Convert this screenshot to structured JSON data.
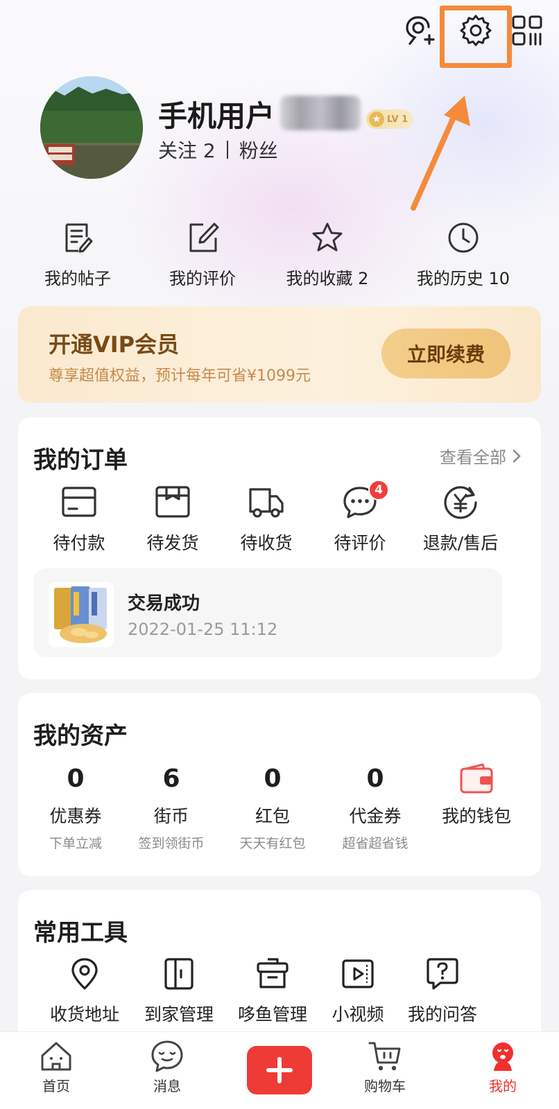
{
  "header": {
    "add_friend_icon": "person-add-icon",
    "settings_icon": "gear-icon",
    "qr_icon": "qr-code-icon",
    "highlight_color": "#f58a3b"
  },
  "profile": {
    "username": "手机用户",
    "level": "LV 1",
    "follow_label": "关注",
    "follow_count": "2",
    "fans_label": "粉丝"
  },
  "quick_links": [
    {
      "label": "我的帖子",
      "icon": "document-edit-icon"
    },
    {
      "label": "我的评价",
      "icon": "edit-square-icon"
    },
    {
      "label": "我的收藏  2",
      "icon": "star-icon"
    },
    {
      "label": "我的历史  10",
      "icon": "clock-icon"
    }
  ],
  "vip": {
    "title": "开通VIP会员",
    "subtitle": "尊享超值权益，预计每年可省¥1099元",
    "button": "立即续费"
  },
  "orders": {
    "title": "我的订单",
    "view_all": "查看全部",
    "items": [
      {
        "label": "待付款",
        "icon": "card-icon"
      },
      {
        "label": "待发货",
        "icon": "box-icon"
      },
      {
        "label": "待收货",
        "icon": "truck-icon"
      },
      {
        "label": "待评价",
        "icon": "chat-bubble-icon",
        "badge": "4"
      },
      {
        "label": "退款/售后",
        "icon": "refund-icon"
      }
    ],
    "recent": {
      "status": "交易成功",
      "time": "2022-01-25 11:12"
    }
  },
  "assets": {
    "title": "我的资产",
    "items": [
      {
        "value": "0",
        "name": "优惠券",
        "desc": "下单立减"
      },
      {
        "value": "6",
        "name": "街币",
        "desc": "签到领街币"
      },
      {
        "value": "0",
        "name": "红包",
        "desc": "天天有红包"
      },
      {
        "value": "0",
        "name": "代金券",
        "desc": "超省超省钱"
      }
    ],
    "wallet_label": "我的钱包"
  },
  "tools": {
    "title": "常用工具",
    "items": [
      {
        "label": "收货地址",
        "icon": "location-pin-icon"
      },
      {
        "label": "到家管理",
        "icon": "door-icon"
      },
      {
        "label": "哆鱼管理",
        "icon": "basket-icon"
      },
      {
        "label": "小视频",
        "icon": "video-icon"
      },
      {
        "label": "我的问答",
        "icon": "question-bubble-icon"
      }
    ]
  },
  "nav": {
    "items": [
      {
        "label": "首页",
        "icon": "home-icon"
      },
      {
        "label": "消息",
        "icon": "message-icon"
      },
      {
        "label": "",
        "icon": "plus-icon"
      },
      {
        "label": "购物车",
        "icon": "cart-icon"
      },
      {
        "label": "我的",
        "icon": "profile-mascot-icon"
      }
    ],
    "active_color": "#f0302e"
  }
}
